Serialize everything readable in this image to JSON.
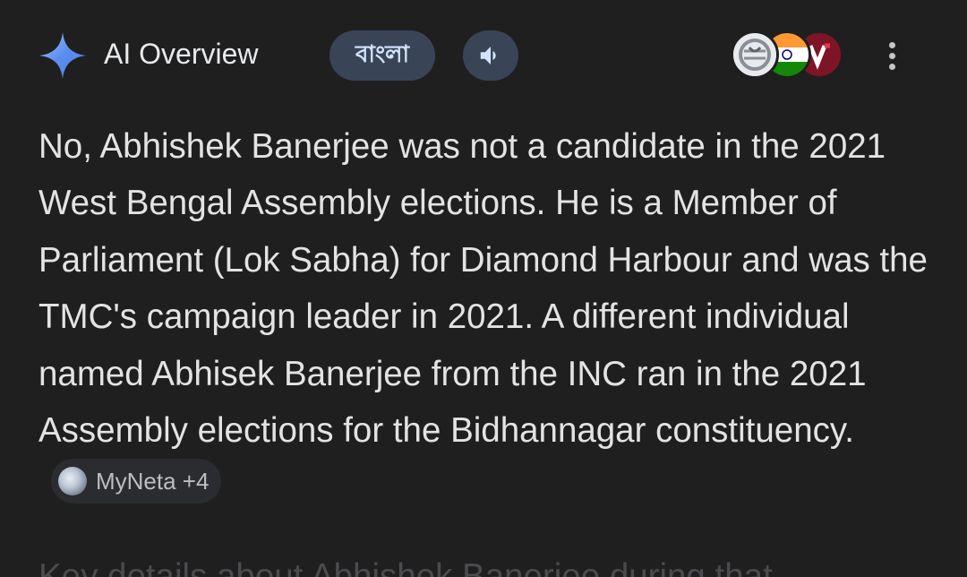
{
  "header": {
    "title": "AI Overview",
    "language_button": "বাংলা",
    "speaker_icon": "speaker-icon",
    "sources": [
      {
        "name": "source-favicon-globe",
        "color": "#dadce0"
      },
      {
        "name": "source-favicon-india-flag",
        "color": "#ff9933"
      },
      {
        "name": "source-favicon-v",
        "color": "#8b1a2b"
      }
    ],
    "more_icon": "more-vertical-icon"
  },
  "answer": {
    "text": "No, Abhishek Banerjee was not a candidate in the 2021 West Bengal Assembly elections. He is a Member of Parliament (Lok Sabha) for Diamond Harbour and was the TMC's campaign leader in 2021. A different individual named Abhisek Banerjee from the INC ran in the 2021 Assembly elections for the Bidhannagar constituency.",
    "citation_label": "MyNeta +4"
  },
  "next_section": {
    "text": "Key details about Abhishek Banerjee during that"
  },
  "colors": {
    "background": "#1f1f1f",
    "text": "#e3e3e3",
    "pill_bg": "#394457",
    "pill_text": "#d3e3fd",
    "sparkle": "#7aa2f7"
  }
}
